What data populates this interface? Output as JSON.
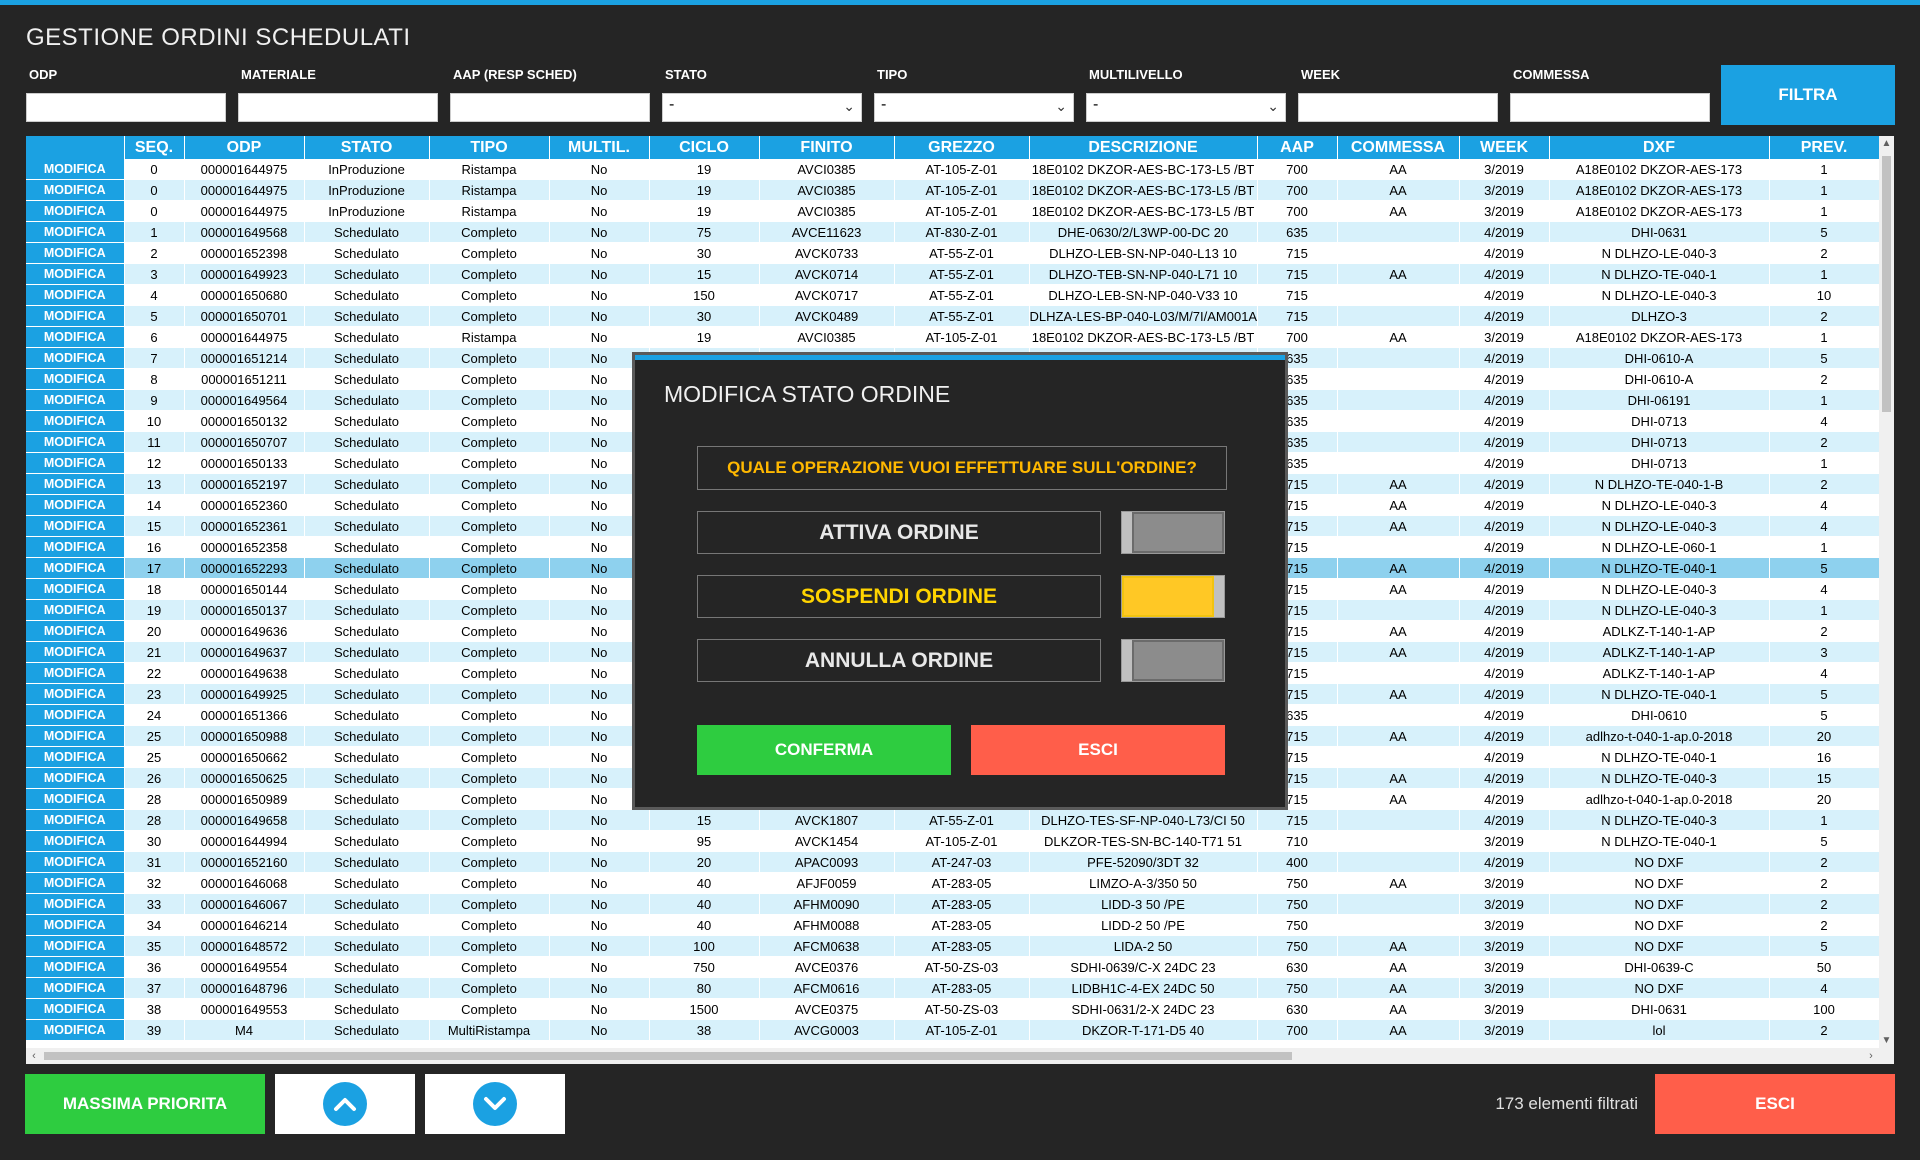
{
  "app": {
    "title": "GESTIONE ORDINI SCHEDULATI"
  },
  "filters": [
    {
      "label": "ODP",
      "type": "text",
      "value": ""
    },
    {
      "label": "MATERIALE",
      "type": "text",
      "value": ""
    },
    {
      "label": "AAP (RESP SCHED)",
      "type": "text",
      "value": ""
    },
    {
      "label": "STATO",
      "type": "select",
      "value": "-"
    },
    {
      "label": "TIPO",
      "type": "select",
      "value": "-"
    },
    {
      "label": "MULTILIVELLO",
      "type": "select",
      "value": "-"
    },
    {
      "label": "WEEK",
      "type": "text",
      "value": ""
    },
    {
      "label": "COMMESSA",
      "type": "text",
      "value": ""
    }
  ],
  "filter_button": "FILTRA",
  "grid": {
    "columns": [
      "",
      "SEQ.",
      "ODP",
      "STATO",
      "TIPO",
      "MULTIL.",
      "CICLO",
      "FINITO",
      "GREZZO",
      "DESCRIZIONE",
      "AAP",
      "COMMESSA",
      "WEEK",
      "DXF",
      "PREV."
    ],
    "action_label": "MODIFICA",
    "selected_index": 19,
    "rows": [
      [
        "0",
        "000001644975",
        "InProduzione",
        "Ristampa",
        "No",
        "19",
        "AVCI0385",
        "AT-105-Z-01",
        "18E0102 DKZOR-AES-BC-173-L5  /BT",
        "700",
        "AA",
        "3/2019",
        "A18E0102 DKZOR-AES-173",
        "1"
      ],
      [
        "0",
        "000001644975",
        "InProduzione",
        "Ristampa",
        "No",
        "19",
        "AVCI0385",
        "AT-105-Z-01",
        "18E0102 DKZOR-AES-BC-173-L5  /BT",
        "700",
        "AA",
        "3/2019",
        "A18E0102 DKZOR-AES-173",
        "1"
      ],
      [
        "0",
        "000001644975",
        "InProduzione",
        "Ristampa",
        "No",
        "19",
        "AVCI0385",
        "AT-105-Z-01",
        "18E0102 DKZOR-AES-BC-173-L5  /BT",
        "700",
        "AA",
        "3/2019",
        "A18E0102 DKZOR-AES-173",
        "1"
      ],
      [
        "1",
        "000001649568",
        "Schedulato",
        "Completo",
        "No",
        "75",
        "AVCE11623",
        "AT-830-Z-01",
        "DHE-0630/2/L3WP-00-DC 20",
        "635",
        "",
        "4/2019",
        "DHI-0631",
        "5"
      ],
      [
        "2",
        "000001652398",
        "Schedulato",
        "Completo",
        "No",
        "30",
        "AVCK0733",
        "AT-55-Z-01",
        "DLHZO-LEB-SN-NP-040-L13 10",
        "715",
        "",
        "4/2019",
        "N DLHZO-LE-040-3",
        "2"
      ],
      [
        "3",
        "000001649923",
        "Schedulato",
        "Completo",
        "No",
        "15",
        "AVCK0714",
        "AT-55-Z-01",
        "DLHZO-TEB-SN-NP-040-L71 10",
        "715",
        "AA",
        "4/2019",
        "N DLHZO-TE-040-1",
        "1"
      ],
      [
        "4",
        "000001650680",
        "Schedulato",
        "Completo",
        "No",
        "150",
        "AVCK0717",
        "AT-55-Z-01",
        "DLHZO-LEB-SN-NP-040-V33 10",
        "715",
        "",
        "4/2019",
        "N DLHZO-LE-040-3",
        "10"
      ],
      [
        "5",
        "000001650701",
        "Schedulato",
        "Completo",
        "No",
        "30",
        "AVCK0489",
        "AT-55-Z-01",
        "DLHZA-LES-BP-040-L03/M/7I/AM001A",
        "715",
        "",
        "4/2019",
        "DLHZO-3",
        "2"
      ],
      [
        "6",
        "000001644975",
        "Schedulato",
        "Ristampa",
        "No",
        "19",
        "AVCI0385",
        "AT-105-Z-01",
        "18E0102 DKZOR-AES-BC-173-L5  /BT",
        "700",
        "AA",
        "3/2019",
        "A18E0102 DKZOR-AES-173",
        "1"
      ],
      [
        "7",
        "000001651214",
        "Schedulato",
        "Completo",
        "No",
        "",
        "",
        "",
        "",
        "635",
        "",
        "4/2019",
        "DHI-0610-A",
        "5"
      ],
      [
        "8",
        "000001651211",
        "Schedulato",
        "Completo",
        "No",
        "",
        "",
        "",
        "",
        "635",
        "",
        "4/2019",
        "DHI-0610-A",
        "2"
      ],
      [
        "9",
        "000001649564",
        "Schedulato",
        "Completo",
        "No",
        "",
        "",
        "",
        "",
        "635",
        "",
        "4/2019",
        "DHI-06191",
        "1"
      ],
      [
        "10",
        "000001650132",
        "Schedulato",
        "Completo",
        "No",
        "",
        "",
        "",
        "",
        "635",
        "",
        "4/2019",
        "DHI-0713",
        "4"
      ],
      [
        "11",
        "000001650707",
        "Schedulato",
        "Completo",
        "No",
        "",
        "",
        "",
        "",
        "635",
        "",
        "4/2019",
        "DHI-0713",
        "2"
      ],
      [
        "12",
        "000001650133",
        "Schedulato",
        "Completo",
        "No",
        "",
        "",
        "",
        "",
        "635",
        "",
        "4/2019",
        "DHI-0713",
        "1"
      ],
      [
        "13",
        "000001652197",
        "Schedulato",
        "Completo",
        "No",
        "",
        "",
        "",
        "",
        "715",
        "AA",
        "4/2019",
        "N DLHZO-TE-040-1-B",
        "2"
      ],
      [
        "14",
        "000001652360",
        "Schedulato",
        "Completo",
        "No",
        "",
        "",
        "",
        "",
        "715",
        "AA",
        "4/2019",
        "N DLHZO-LE-040-3",
        "4"
      ],
      [
        "15",
        "000001652361",
        "Schedulato",
        "Completo",
        "No",
        "",
        "",
        "",
        "",
        "715",
        "AA",
        "4/2019",
        "N DLHZO-LE-040-3",
        "4"
      ],
      [
        "16",
        "000001652358",
        "Schedulato",
        "Completo",
        "No",
        "",
        "",
        "",
        "",
        "715",
        "",
        "4/2019",
        "N DLHZO-LE-060-1",
        "1"
      ],
      [
        "17",
        "000001652293",
        "Schedulato",
        "Completo",
        "No",
        "",
        "",
        "",
        "",
        "715",
        "AA",
        "4/2019",
        "N DLHZO-TE-040-1",
        "5"
      ],
      [
        "18",
        "000001650144",
        "Schedulato",
        "Completo",
        "No",
        "",
        "",
        "",
        "",
        "715",
        "AA",
        "4/2019",
        "N DLHZO-LE-040-3",
        "4"
      ],
      [
        "19",
        "000001650137",
        "Schedulato",
        "Completo",
        "No",
        "",
        "",
        "",
        "",
        "715",
        "",
        "4/2019",
        "N DLHZO-LE-040-3",
        "1"
      ],
      [
        "20",
        "000001649636",
        "Schedulato",
        "Completo",
        "No",
        "",
        "",
        "",
        "",
        "715",
        "AA",
        "4/2019",
        "ADLKZ-T-140-1-AP",
        "2"
      ],
      [
        "21",
        "000001649637",
        "Schedulato",
        "Completo",
        "No",
        "",
        "",
        "",
        "",
        "715",
        "AA",
        "4/2019",
        "ADLKZ-T-140-1-AP",
        "3"
      ],
      [
        "22",
        "000001649638",
        "Schedulato",
        "Completo",
        "No",
        "",
        "",
        "",
        "",
        "715",
        "",
        "4/2019",
        "ADLKZ-T-140-1-AP",
        "4"
      ],
      [
        "23",
        "000001649925",
        "Schedulato",
        "Completo",
        "No",
        "",
        "",
        "",
        "",
        "715",
        "AA",
        "4/2019",
        "N DLHZO-TE-040-1",
        "5"
      ],
      [
        "24",
        "000001651366",
        "Schedulato",
        "Completo",
        "No",
        "",
        "",
        "",
        "",
        "635",
        "",
        "4/2019",
        "DHI-0610",
        "5"
      ],
      [
        "25",
        "000001650988",
        "Schedulato",
        "Completo",
        "No",
        "",
        "",
        "",
        "",
        "715",
        "AA",
        "4/2019",
        "adlhzo-t-040-1-ap.0-2018",
        "20"
      ],
      [
        "25",
        "000001650662",
        "Schedulato",
        "Completo",
        "No",
        "",
        "",
        "",
        "",
        "715",
        "",
        "4/2019",
        "N DLHZO-TE-040-1",
        "16"
      ],
      [
        "26",
        "000001650625",
        "Schedulato",
        "Completo",
        "No",
        "",
        "",
        "",
        "",
        "715",
        "AA",
        "4/2019",
        "N DLHZO-TE-040-3",
        "15"
      ],
      [
        "28",
        "000001650989",
        "Schedulato",
        "Completo",
        "No",
        "",
        "",
        "",
        "",
        "715",
        "AA",
        "4/2019",
        "adlhzo-t-040-1-ap.0-2018",
        "20"
      ],
      [
        "28",
        "000001649658",
        "Schedulato",
        "Completo",
        "No",
        "15",
        "AVCK1807",
        "AT-55-Z-01",
        "DLHZO-TES-SF-NP-040-L73/CI 50",
        "715",
        "",
        "4/2019",
        "N DLHZO-TE-040-3",
        "1"
      ],
      [
        "30",
        "000001644994",
        "Schedulato",
        "Completo",
        "No",
        "95",
        "AVCK1454",
        "AT-105-Z-01",
        "DLKZOR-TES-SN-BC-140-T71 51",
        "710",
        "",
        "3/2019",
        "N DLHZO-TE-040-1",
        "5"
      ],
      [
        "31",
        "000001652160",
        "Schedulato",
        "Completo",
        "No",
        "20",
        "APAC0093",
        "AT-247-03",
        "PFE-52090/3DT 32",
        "400",
        "",
        "4/2019",
        "NO DXF",
        "2"
      ],
      [
        "32",
        "000001646068",
        "Schedulato",
        "Completo",
        "No",
        "40",
        "AFJF0059",
        "AT-283-05",
        "LIMZO-A-3/350 50",
        "750",
        "AA",
        "3/2019",
        "NO DXF",
        "2"
      ],
      [
        "33",
        "000001646067",
        "Schedulato",
        "Completo",
        "No",
        "40",
        "AFHM0090",
        "AT-283-05",
        "LIDD-3 50  /PE",
        "750",
        "",
        "3/2019",
        "NO DXF",
        "2"
      ],
      [
        "34",
        "000001646214",
        "Schedulato",
        "Completo",
        "No",
        "40",
        "AFHM0088",
        "AT-283-05",
        "LIDD-2 50  /PE",
        "750",
        "",
        "3/2019",
        "NO DXF",
        "2"
      ],
      [
        "35",
        "000001648572",
        "Schedulato",
        "Completo",
        "No",
        "100",
        "AFCM0638",
        "AT-283-05",
        "LIDA-2 50",
        "750",
        "AA",
        "3/2019",
        "NO DXF",
        "5"
      ],
      [
        "36",
        "000001649554",
        "Schedulato",
        "Completo",
        "No",
        "750",
        "AVCE0376",
        "AT-50-ZS-03",
        "SDHI-0639/C-X 24DC 23",
        "630",
        "AA",
        "3/2019",
        "DHI-0639-C",
        "50"
      ],
      [
        "37",
        "000001648796",
        "Schedulato",
        "Completo",
        "No",
        "80",
        "AFCM0616",
        "AT-283-05",
        "LIDBH1C-4-EX 24DC 50",
        "750",
        "AA",
        "3/2019",
        "NO DXF",
        "4"
      ],
      [
        "38",
        "000001649553",
        "Schedulato",
        "Completo",
        "No",
        "1500",
        "AVCE0375",
        "AT-50-ZS-03",
        "SDHI-0631/2-X 24DC 23",
        "630",
        "AA",
        "3/2019",
        "DHI-0631",
        "100"
      ],
      [
        "39",
        "M4",
        "Schedulato",
        "MultiRistampa",
        "No",
        "38",
        "AVCG0003",
        "AT-105-Z-01",
        "DKZOR-T-171-D5 40",
        "700",
        "AA",
        "3/2019",
        "lol",
        "2"
      ]
    ]
  },
  "bottom": {
    "priority_label": "MASSIMA PRIORITA",
    "up_icon": "chevron-up-icon",
    "down_icon": "chevron-down-icon",
    "count_text": "173 elementi filtrati",
    "exit_label": "ESCI"
  },
  "modal": {
    "title": "MODIFICA STATO ORDINE",
    "question": "QUALE OPERAZIONE VUOI EFFETTUARE SULL'ORDINE?",
    "options": [
      {
        "label": "ATTIVA ORDINE",
        "on": false
      },
      {
        "label": "SOSPENDI ORDINE",
        "on": true
      },
      {
        "label": "ANNULLA ORDINE",
        "on": false
      }
    ],
    "confirm_label": "CONFERMA",
    "exit_label": "ESCI"
  },
  "colors": {
    "accent": "#1ba1e2",
    "background": "#252525",
    "row_alt": "#d7f1fb",
    "row_selected": "#8ed1ee",
    "success": "#2ecc40",
    "danger": "#ff5e4a",
    "warning": "#ffc825"
  }
}
